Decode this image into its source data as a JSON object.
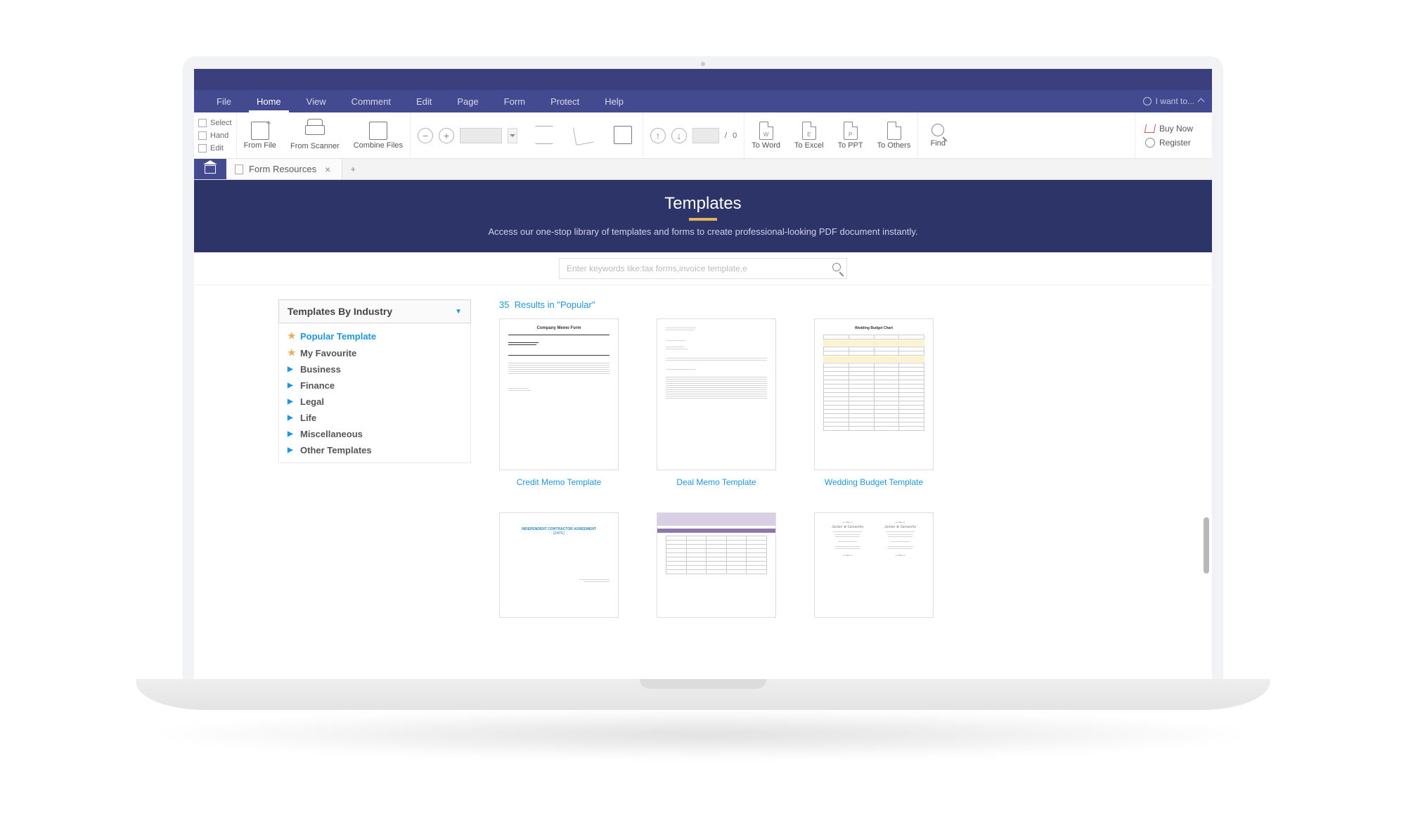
{
  "menu": {
    "items": [
      "File",
      "Home",
      "View",
      "Comment",
      "Edit",
      "Page",
      "Form",
      "Protect",
      "Help"
    ],
    "active": "Home",
    "iwant": "I want to..."
  },
  "ribbon": {
    "tools": {
      "select": "Select",
      "hand": "Hand",
      "edit": "Edit"
    },
    "from_file": "From File",
    "from_scanner": "From Scanner",
    "combine_files": "Combine Files",
    "page_sep": "/",
    "page_total": "0",
    "to_word": "To Word",
    "to_excel": "To Excel",
    "to_ppt": "To PPT",
    "to_others": "To Others",
    "find": "Find",
    "buy_now": "Buy Now",
    "register": "Register"
  },
  "tabs": {
    "doc_name": "Form Resources"
  },
  "hero": {
    "title": "Templates",
    "subtitle": "Access our one-stop library of templates and forms to create professional-looking PDF document instantly."
  },
  "search": {
    "placeholder": "Enter keywords like:tax forms,invoice template,e"
  },
  "sidebar": {
    "header": "Templates By Industry",
    "items": [
      {
        "label": "Popular Template",
        "icon": "star",
        "active": true
      },
      {
        "label": "My Favourite",
        "icon": "star",
        "active": false
      },
      {
        "label": "Business",
        "icon": "arrow",
        "active": false
      },
      {
        "label": "Finance",
        "icon": "arrow",
        "active": false
      },
      {
        "label": "Legal",
        "icon": "arrow",
        "active": false
      },
      {
        "label": "Life",
        "icon": "arrow",
        "active": false
      },
      {
        "label": "Miscellaneous",
        "icon": "arrow",
        "active": false
      },
      {
        "label": "Other Templates",
        "icon": "arrow",
        "active": false
      }
    ]
  },
  "results": {
    "count": "35",
    "label": "Results in \"Popular\"",
    "cards": [
      {
        "title": "Credit Memo Template"
      },
      {
        "title": "Deal Memo Template"
      },
      {
        "title": "Wedding Budget Template"
      },
      {
        "title": ""
      },
      {
        "title": ""
      },
      {
        "title": ""
      }
    ]
  }
}
